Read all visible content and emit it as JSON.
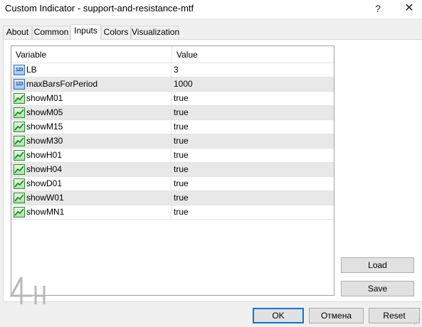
{
  "window": {
    "title": "Custom Indicator - support-and-resistance-mtf",
    "help_glyph": "?",
    "close_glyph": "✕"
  },
  "tabs": [
    {
      "label": "About"
    },
    {
      "label": "Common"
    },
    {
      "label": "Inputs",
      "active": true
    },
    {
      "label": "Colors"
    },
    {
      "label": "Visualization"
    }
  ],
  "grid": {
    "headers": {
      "variable": "Variable",
      "value": "Value"
    },
    "rows": [
      {
        "icon": "numeric-icon",
        "name": "LB",
        "value": "3"
      },
      {
        "icon": "numeric-icon",
        "name": "maxBarsForPeriod",
        "value": "1000"
      },
      {
        "icon": "boolean-icon",
        "name": "showM01",
        "value": "true"
      },
      {
        "icon": "boolean-icon",
        "name": "showM05",
        "value": "true"
      },
      {
        "icon": "boolean-icon",
        "name": "showM15",
        "value": "true"
      },
      {
        "icon": "boolean-icon",
        "name": "showM30",
        "value": "true"
      },
      {
        "icon": "boolean-icon",
        "name": "showH01",
        "value": "true"
      },
      {
        "icon": "boolean-icon",
        "name": "showH04",
        "value": "true"
      },
      {
        "icon": "boolean-icon",
        "name": "showD01",
        "value": "true"
      },
      {
        "icon": "boolean-icon",
        "name": "showW01",
        "value": "true"
      },
      {
        "icon": "boolean-icon",
        "name": "showMN1",
        "value": "true"
      }
    ],
    "numeric_icon_text": "123"
  },
  "buttons": {
    "load": "Load",
    "save": "Save",
    "ok": "OK",
    "cancel": "Отмена",
    "reset": "Reset"
  },
  "colors": {
    "accent": "#0078d7",
    "row_alt": "#e8e8e8"
  }
}
